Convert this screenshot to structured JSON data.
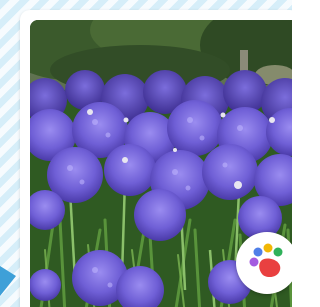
{
  "image": {
    "subject": "",
    "palette": {
      "background_stripe_light": "#f6fbfe",
      "background_stripe_blue": "#d6eef9",
      "card": "#ffffff",
      "flower": "#6f5fd6",
      "foliage": "#3f6b2c"
    }
  },
  "overlay": {
    "badge_icon": "photos-app-icon",
    "badge_dot_colors": [
      "#4f7fe8",
      "#f2b705",
      "#2fb15a",
      "#e94040",
      "#a45be0"
    ],
    "arrow_icon": "arrow-icon"
  }
}
